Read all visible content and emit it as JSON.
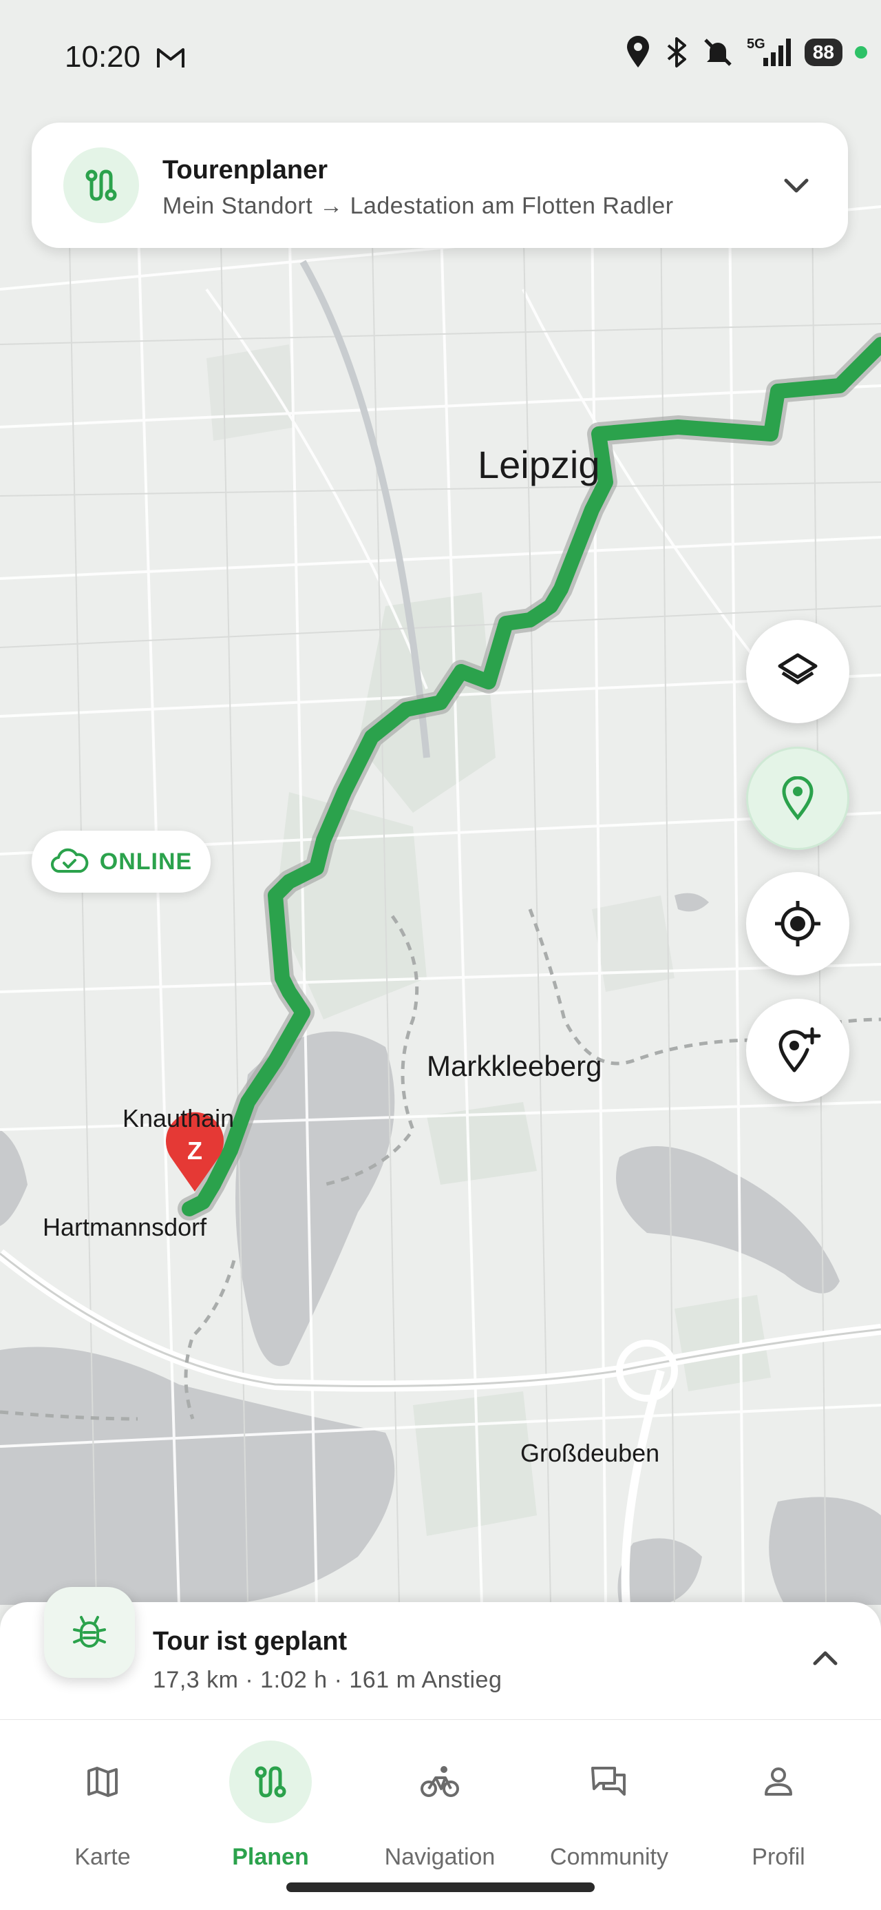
{
  "status_bar": {
    "time": "10:20",
    "network": "5G",
    "battery": "88"
  },
  "planner": {
    "title": "Tourenplaner",
    "route": "Mein Standort → Ladestation am Flotten Radler"
  },
  "map": {
    "labels": {
      "leipzig": "Leipzig",
      "markkleeberg": "Markkleeberg",
      "knautha": "Knauthain",
      "hartmannsdorf": "Hartmannsdorf",
      "grossdeuben": "Großdeuben"
    },
    "marker_letter": "Z",
    "route_color": "#2ba24c",
    "marker_color": "#e53935"
  },
  "connection": {
    "label": "ONLINE"
  },
  "tour": {
    "title": "Tour ist geplant",
    "stats": "17,3 km · 1:02 h · 161 m Anstieg"
  },
  "nav": {
    "items": [
      {
        "label": "Karte",
        "icon": "map-icon"
      },
      {
        "label": "Planen",
        "icon": "route-icon"
      },
      {
        "label": "Navigation",
        "icon": "bike-icon"
      },
      {
        "label": "Community",
        "icon": "chat-icon"
      },
      {
        "label": "Profil",
        "icon": "person-icon"
      }
    ],
    "active": "Planen"
  },
  "colors": {
    "accent": "#2ba24c",
    "accent_light": "#e4f4e7",
    "water": "#c8cacc",
    "background": "#eceeec"
  }
}
